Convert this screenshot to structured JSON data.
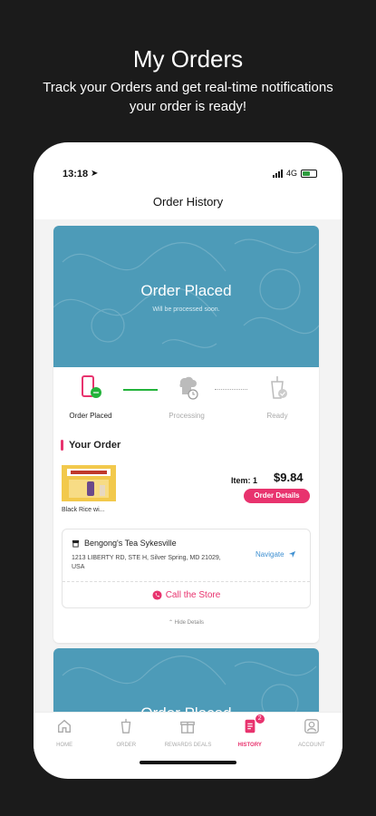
{
  "promo": {
    "title": "My Orders",
    "subtitle": "Track your Orders and get real-time notifications your order is ready!"
  },
  "status_bar": {
    "time": "13:18",
    "network": "4G"
  },
  "header": {
    "title": "Order History"
  },
  "orders": [
    {
      "status_title": "Order Placed",
      "status_sub": "Will be processed soon.",
      "steps": [
        {
          "label": "Order Placed",
          "state": "active"
        },
        {
          "label": "Processing",
          "state": "pending"
        },
        {
          "label": "Ready",
          "state": "pending"
        }
      ],
      "section_title": "Your Order",
      "item_name": "Black Rice wi...",
      "item_count_label": "Item: 1",
      "total": "$9.84",
      "details_button": "Order Details",
      "store": {
        "name": "Bengong's Tea Sykesville",
        "address": "1213 LIBERTY RD, STE H, Silver Spring, MD 21029, USA",
        "navigate_label": "Navigate",
        "call_label": "Call the Store"
      },
      "hide_details_label": "Hide Details"
    },
    {
      "status_title": "Order Placed"
    }
  ],
  "tabbar": {
    "items": [
      {
        "label": "HOME",
        "icon": "home-icon"
      },
      {
        "label": "ORDER",
        "icon": "cup-icon"
      },
      {
        "label": "REWARDS DEALS",
        "icon": "gift-icon"
      },
      {
        "label": "HISTORY",
        "icon": "history-icon",
        "badge": "2",
        "active": true
      },
      {
        "label": "ACCOUNT",
        "icon": "account-icon"
      }
    ]
  },
  "colors": {
    "accent": "#e8336e",
    "banner": "#4d9bb8",
    "progress": "#23b33b",
    "link": "#3d8fd1"
  }
}
